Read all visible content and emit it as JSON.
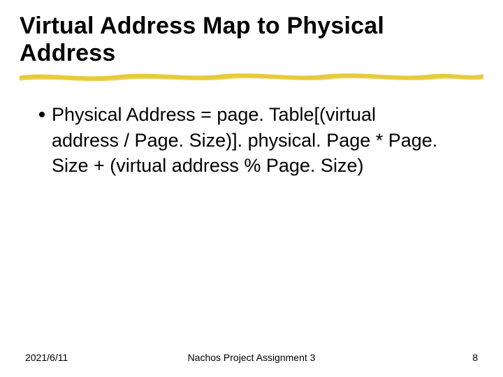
{
  "title": "Virtual Address Map to Physical Address",
  "bullets": [
    {
      "text": "Physical Address = page. Table[(virtual address / Page. Size)]. physical. Page * Page. Size + (virtual address % Page. Size)"
    }
  ],
  "footer": {
    "date": "2021/6/11",
    "center": "Nachos Project Assignment 3",
    "page": "8"
  },
  "colors": {
    "underline": "#e8c93a"
  }
}
